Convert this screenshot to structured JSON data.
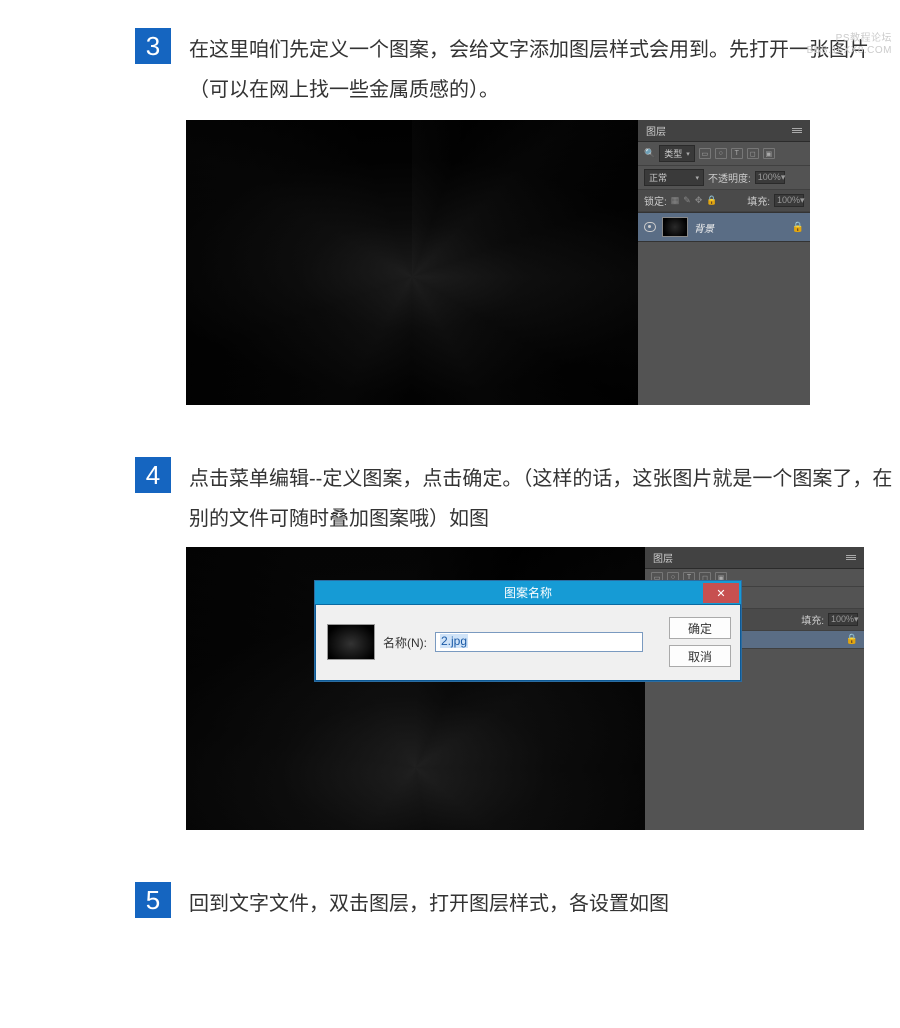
{
  "watermark": {
    "line1": "PS教程论坛",
    "line2": "BBS.16XX8.COM"
  },
  "step3": {
    "num": "3",
    "text": "在这里咱们先定义一个图案，会给文字添加图层样式会用到。先打开一张图片（可以在网上找一些金属质感的）。"
  },
  "step4": {
    "num": "4",
    "text": "点击菜单编辑--定义图案，点击确定。（这样的话，这张图片就是一个图案了，在别的文件可随时叠加图案哦）如图"
  },
  "step5": {
    "num": "5",
    "text": "回到文字文件，双击图层，打开图层样式，各设置如图"
  },
  "layers_panel": {
    "tab": "图层",
    "kind_label": "类型",
    "blend_mode": "正常",
    "opacity_label": "不透明度:",
    "opacity_value": "100%",
    "lock_label": "锁定:",
    "fill_label": "填充:",
    "fill_value": "100%",
    "layer_name": "背景",
    "icon_T": "T",
    "icon_img": "▭",
    "icon_circle": "○"
  },
  "dialog": {
    "title": "图案名称",
    "name_label": "名称(N):",
    "name_value": "2.jpg",
    "ok": "确定",
    "cancel": "取消"
  }
}
